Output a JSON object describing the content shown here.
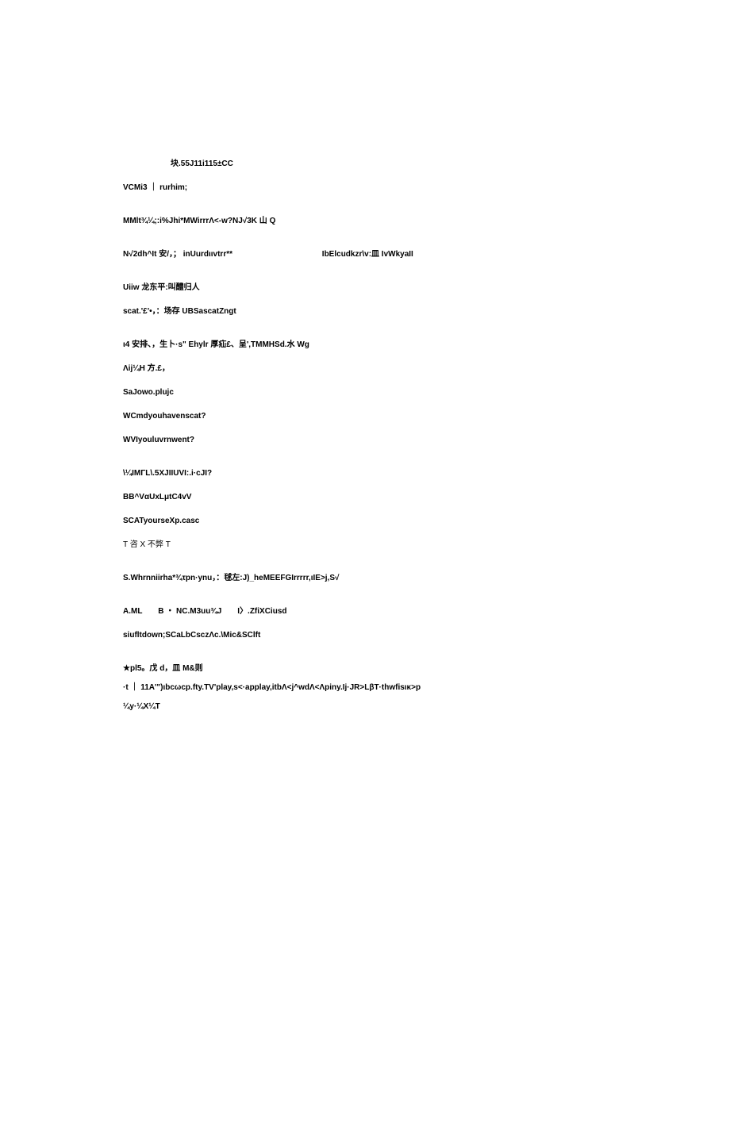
{
  "lines": {
    "l1": "块.55J11i115±CC",
    "l2a": "VCMi3",
    "l2b": "rurhim;",
    "l3": "MMlt¾¼;:i%Jhi*MWirrrΛ<-w?NJ√3K 山 Q",
    "l4a": "N√2dh^It 安/，； inUurdιιvtrr**",
    "l4b": "IbElcudkzr\\v:皿 IvWkyaII",
    "l5": "Uiiw 龙东平:叫醴归人",
    "l6": "scat.'£'•，：场存 UBSascatZngt",
    "l7": "ι4 安排、，生卜·s\" Ehylr 厚疝£、呈',TMMHSd.水 Wg",
    "l8": "Λij¼H 方.£，",
    "l9": "SaJowo.plujc",
    "l10": "WCmdyouhavenscat?",
    "l11": "WVIyouluvrnwent?",
    "l12": "\\¼IMΓL\\.5XJIIUVI:.i·cJI?",
    "l13": "BB^VαUxLμtC4vV",
    "l14": "SCATyourseXp.casc",
    "l15": "T 咨 X 不弊 T",
    "l16": "S.Whrnniirha*¾τpn·ynu，：毬左:J)_heMEEFGIrrrrr,ιIE>j,S√",
    "l17": "A.ML　　B ・ NC.M3uu¾J　　I〉.ZfiXCiusd",
    "l18": "siufltdown;SCaLbCsczΛc.\\Mic&SClft",
    "l19": "★pl5。戊 d，皿 M&则",
    "l20a": "·t",
    "l20b": "11A'\")ιbcωcp.fty.TV'play,s<·applay,itbΛ<j^wdΛ<Λpiny.Ij·JR>LβT·thwfisικ>p",
    "l21": "¼y·¼X¼T"
  }
}
